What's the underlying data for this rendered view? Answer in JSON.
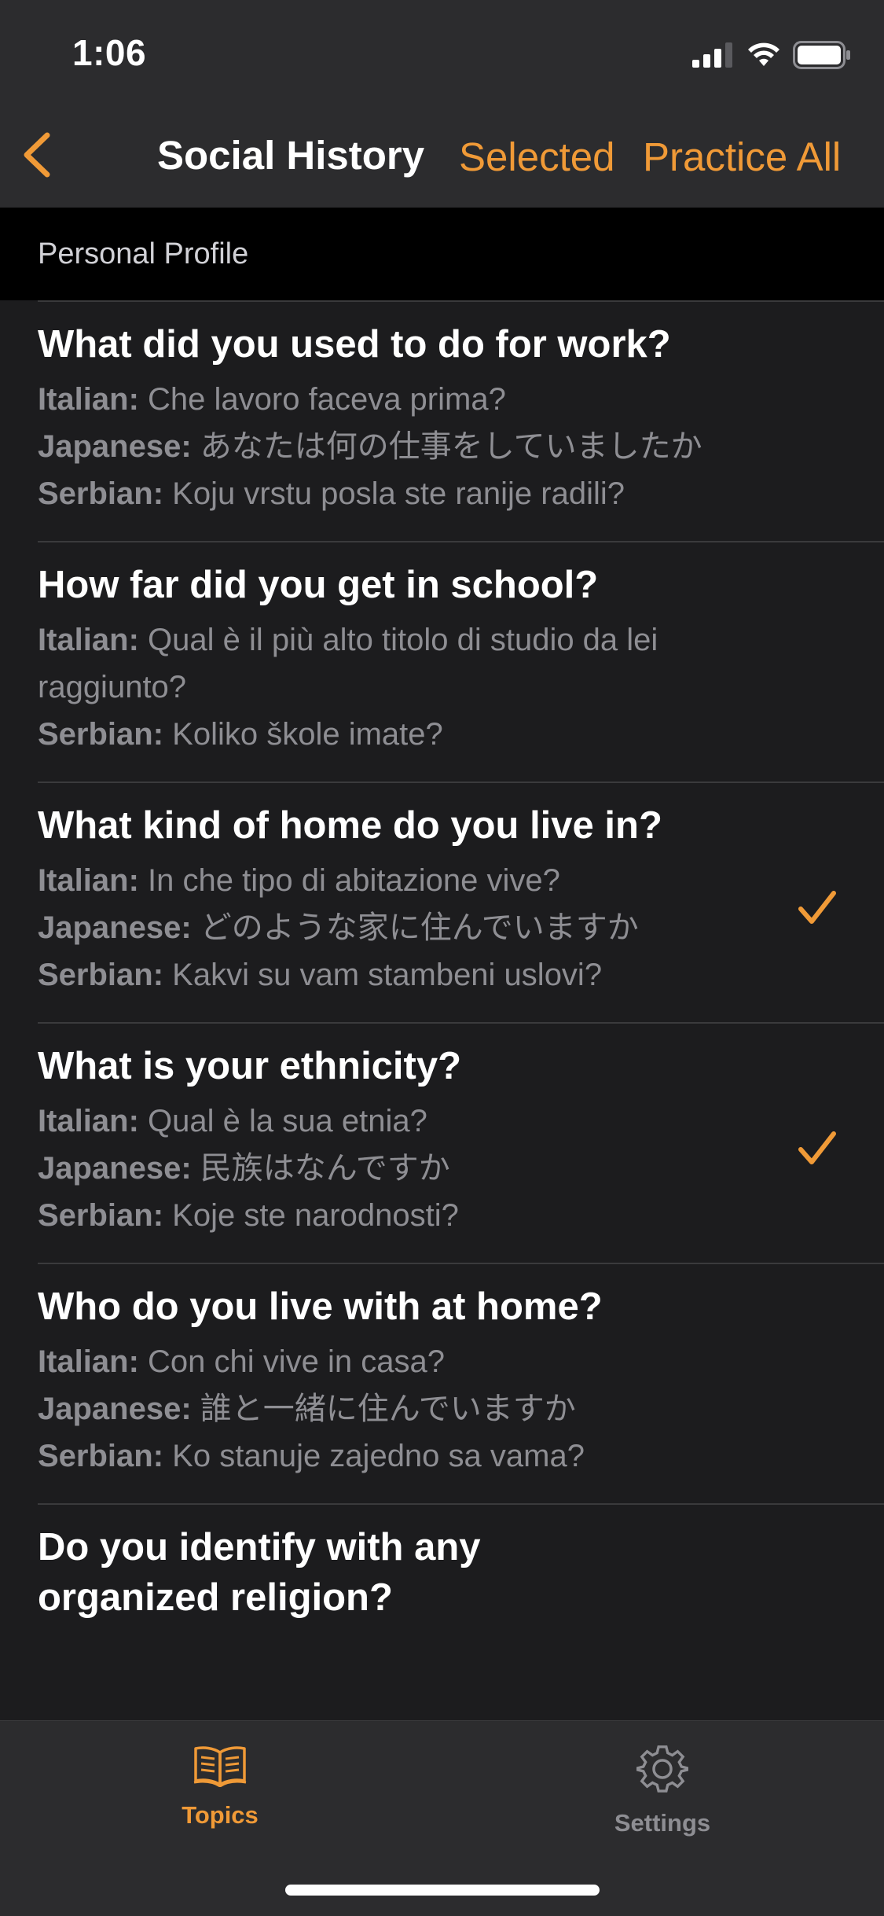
{
  "status_bar": {
    "time": "1:06"
  },
  "nav": {
    "title": "Social History",
    "selected_label": "Selected",
    "practice_all_label": "Practice All",
    "back_icon": "chevron-left-icon"
  },
  "section": {
    "title": "Personal Profile"
  },
  "colors": {
    "accent": "#f09a37",
    "background": "#1c1c1e",
    "bar": "#2c2c2e",
    "secondary_text": "#8e8e93"
  },
  "labels": {
    "italian": "Italian:",
    "japanese": "Japanese:",
    "serbian": "Serbian:"
  },
  "items": [
    {
      "question": "What did you used to do for work?",
      "italian": "Che lavoro faceva prima?",
      "japanese": "あなたは何の仕事をしていましたか",
      "serbian": "Koju vrstu posla ste ranije radili?",
      "selected": false
    },
    {
      "question": "How far did you get in school?",
      "italian": "Qual è il più alto titolo di studio da lei raggiunto?",
      "serbian": "Koliko škole imate?",
      "selected": false
    },
    {
      "question": "What kind of home do you live in?",
      "italian": "In che tipo di abitazione vive?",
      "japanese": "どのような家に住んでいますか",
      "serbian": "Kakvi su vam stambeni uslovi?",
      "selected": true
    },
    {
      "question": "What is your ethnicity?",
      "italian": "Qual è la sua etnia?",
      "japanese": "民族はなんですか",
      "serbian": "Koje ste narodnosti?",
      "selected": true
    },
    {
      "question": "Who do you live with at home?",
      "italian": "Con chi vive in casa?",
      "japanese": "誰と一緒に住んでいますか",
      "serbian": "Ko stanuje zajedno sa vama?",
      "selected": false
    },
    {
      "question": "Do you identify with any organized religion?"
    }
  ],
  "tabbar": {
    "topics_label": "Topics",
    "topics_icon": "book-icon",
    "settings_label": "Settings",
    "settings_icon": "gear-icon",
    "active_tab": "Topics"
  }
}
